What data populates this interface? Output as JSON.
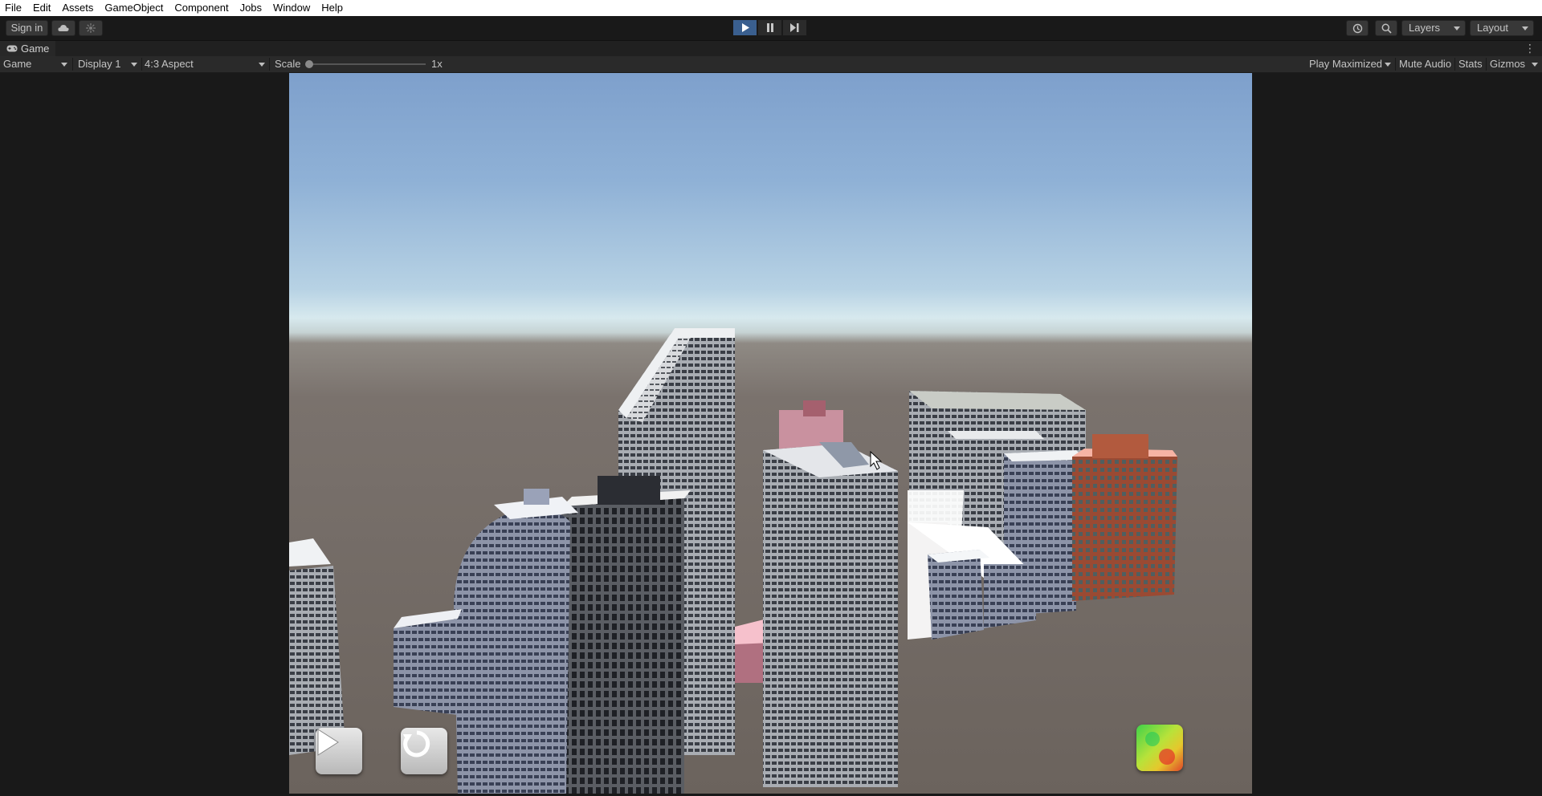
{
  "menubar": {
    "items": [
      "File",
      "Edit",
      "Assets",
      "GameObject",
      "Component",
      "Jobs",
      "Window",
      "Help"
    ]
  },
  "toolbar": {
    "sign_in_label": "Sign in",
    "layers_label": "Layers",
    "layout_label": "Layout",
    "play_state": "playing"
  },
  "tab": {
    "label": "Game"
  },
  "game_view": {
    "mode_label": "Game",
    "display_label": "Display 1",
    "aspect_label": "4:3 Aspect",
    "scale_label": "Scale",
    "scale_value": "1x",
    "play_maximized_label": "Play Maximized",
    "mute_audio_label": "Mute Audio",
    "stats_label": "Stats",
    "gizmos_label": "Gizmos"
  },
  "colors": {
    "accent_play": "#3a5f8f",
    "sky_top": "#7ea0cc",
    "ground": "#6b635d"
  }
}
